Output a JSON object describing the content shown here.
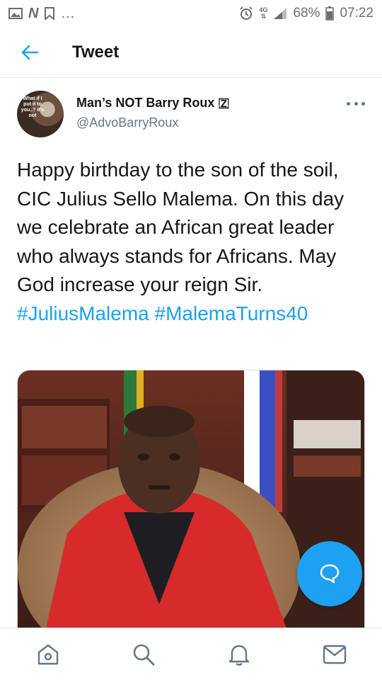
{
  "status_bar": {
    "percent": "68%",
    "time": "07:22",
    "network": "4G",
    "overflow": "...",
    "icons": [
      "image-icon",
      "n-app-icon",
      "bookmark-check-icon",
      "alarm-icon",
      "network-4g-icon",
      "signal-icon",
      "battery-icon"
    ]
  },
  "header": {
    "title": "Tweet",
    "back_icon": "back-arrow-icon"
  },
  "tweet": {
    "author_name": "Man’s NOT Barry Roux 🇿",
    "author_handle": "@AdvoBarryRoux",
    "avatar_text": "What if I put it to you..? it's not",
    "text": "Happy birthday to the son of the soil, CIC Julius Sello Malema. On this day we celebrate an African great leader who always stands for Africans. May God increase your reign Sir.",
    "hashtags": [
      "#JuliusMalema",
      "#MalemaTurns40"
    ]
  },
  "media": {
    "description_icon": "photo-icon",
    "colors": {
      "jacket": "#d62b2b",
      "background": "#5a2a20",
      "skin": "#4a2f22"
    }
  },
  "colors": {
    "accent": "#1da1f2",
    "text": "#14171a",
    "secondary": "#657786",
    "divider": "#e1e8ed"
  },
  "bottom_nav": {
    "items": [
      "home-icon",
      "search-icon",
      "notifications-icon",
      "messages-icon"
    ]
  },
  "fab": {
    "icon": "compose-reply-icon"
  }
}
